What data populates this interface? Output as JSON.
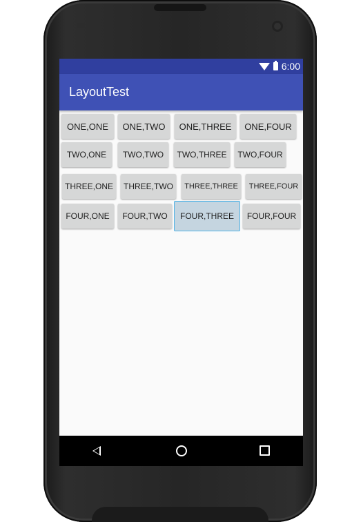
{
  "app": {
    "title": "LayoutTest"
  },
  "status_bar": {
    "time": "6:00",
    "icons": [
      "wifi-icon",
      "battery-icon"
    ]
  },
  "grid": {
    "rows": [
      [
        "ONE,ONE",
        "ONE,TWO",
        "ONE,THREE",
        "ONE,FOUR"
      ],
      [
        "TWO,ONE",
        "TWO,TWO",
        "TWO,THREE",
        "TWO,FOUR"
      ],
      [
        "THREE,ONE",
        "THREE,TWO",
        "THREE,THREE",
        "THREE,FOUR"
      ],
      [
        "FOUR,ONE",
        "FOUR,TWO",
        "FOUR,THREE",
        "FOUR,FOUR"
      ]
    ],
    "selected": "FOUR,THREE"
  },
  "nav_bar": {
    "icons": [
      "back-icon",
      "home-icon",
      "recents-icon"
    ]
  },
  "colors": {
    "status_bar": "#303f9f",
    "app_bar": "#3f51b5",
    "button": "#d6d7d7",
    "button_selected": "#c5d5e0",
    "selected_border": "#4fb3e6",
    "screen_background": "#fafafa"
  }
}
